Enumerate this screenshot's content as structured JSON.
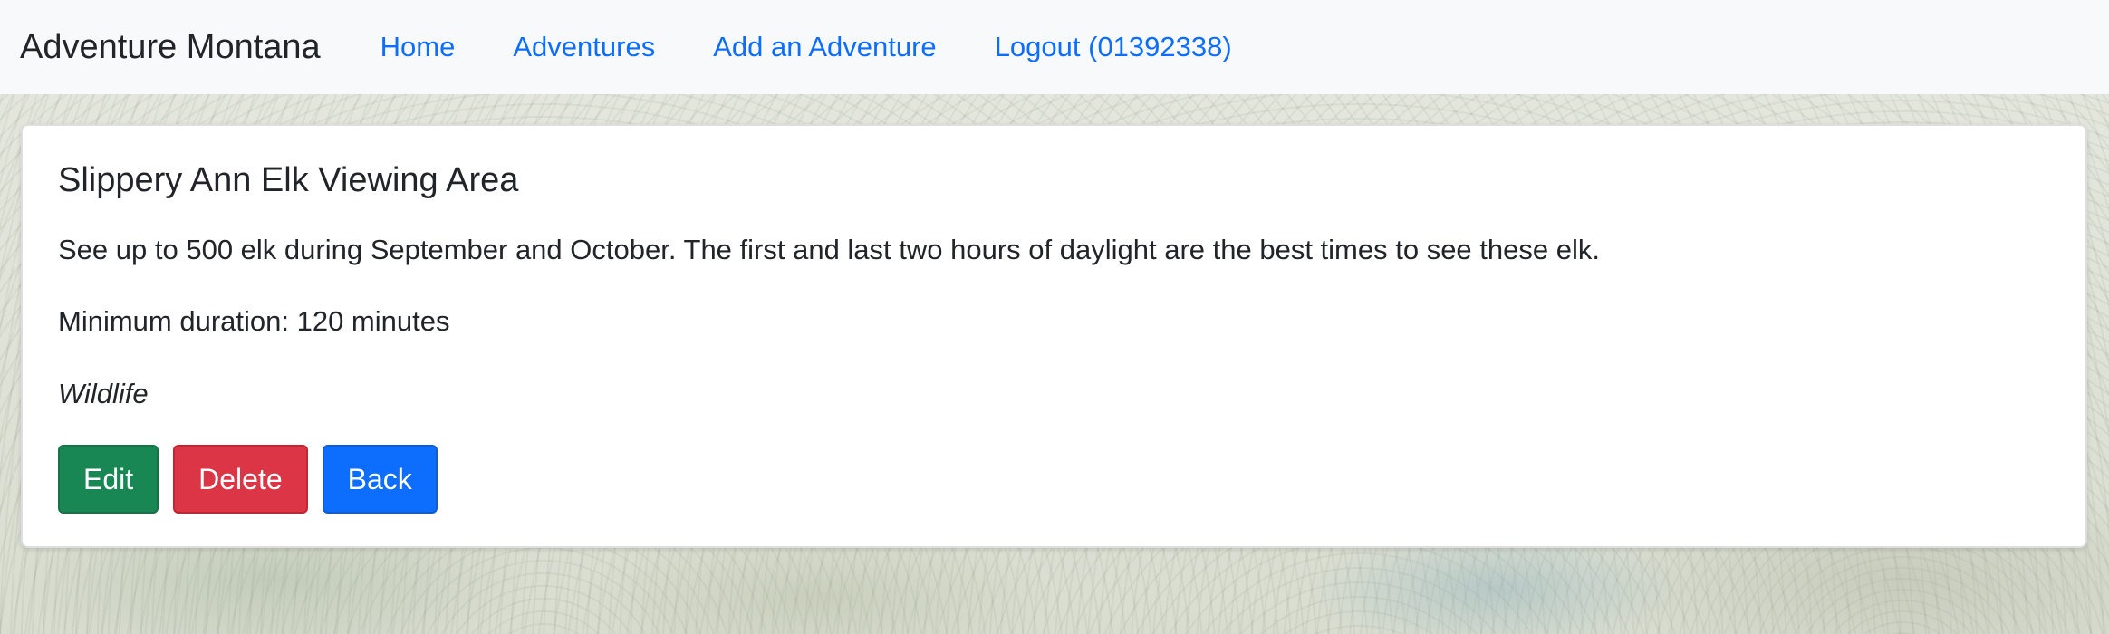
{
  "navbar": {
    "brand": "Adventure Montana",
    "links": [
      {
        "label": "Home"
      },
      {
        "label": "Adventures"
      },
      {
        "label": "Add an Adventure"
      },
      {
        "label": "Logout (01392338)"
      }
    ]
  },
  "adventure": {
    "title": "Slippery Ann Elk Viewing Area",
    "description": "See up to 500 elk during September and October. The first and last two hours of daylight are the best times to see these elk.",
    "duration": "Minimum duration: 120 minutes",
    "category": "Wildlife"
  },
  "actions": {
    "edit_label": "Edit",
    "delete_label": "Delete",
    "back_label": "Back"
  },
  "colors": {
    "navbar_bg": "#f8f9fa",
    "link": "#0d6efd",
    "edit": "#198754",
    "delete": "#dc3545",
    "back": "#0d6efd"
  }
}
